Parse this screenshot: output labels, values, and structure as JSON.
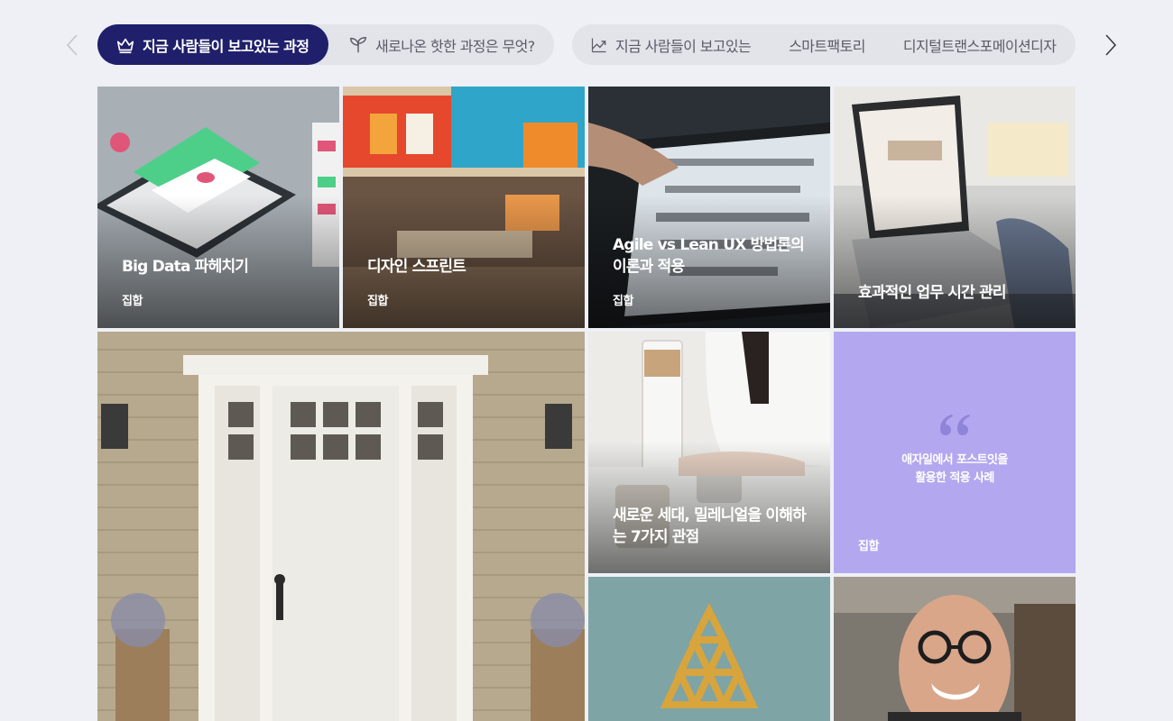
{
  "nav": {
    "prev_icon": "chevron-left-icon",
    "next_icon": "chevron-right-icon"
  },
  "tabs": [
    {
      "label": "지금 사람들이 보고있는 과정",
      "icon": "crown-icon",
      "active": true
    },
    {
      "label": "새로나온 핫한 과정은 무엇?",
      "icon": "sprout-icon",
      "active": false
    }
  ],
  "keywords": {
    "lead_icon": "trending-up-icon",
    "items": [
      "지금 사람들이 보고있는",
      "스마트팩토리",
      "디지털트랜스포메이션디자"
    ]
  },
  "cards": {
    "bigdata": {
      "title": "Big Data 파헤치기",
      "tag": "집합"
    },
    "design_sprint": {
      "title": "디자인 스프린트",
      "tag": "집합"
    },
    "agile_lean": {
      "title": "Agile vs Lean UX 방법론의 이론과 적용",
      "tag": "집합"
    },
    "time_mgmt": {
      "title": "효과적인 업무 시간 관리"
    },
    "millennial": {
      "title": "새로운 세대, 밀레니얼을 이해하는 7가지 관점"
    },
    "quote": {
      "text_line1": "애자일에서 포스트잇을",
      "text_line2": "활용한 적용 사례",
      "tag": "집합"
    }
  },
  "colors": {
    "active_tab": "#1f1f6b",
    "quote_card": "#b3a8ef",
    "background": "#eef0f5"
  }
}
